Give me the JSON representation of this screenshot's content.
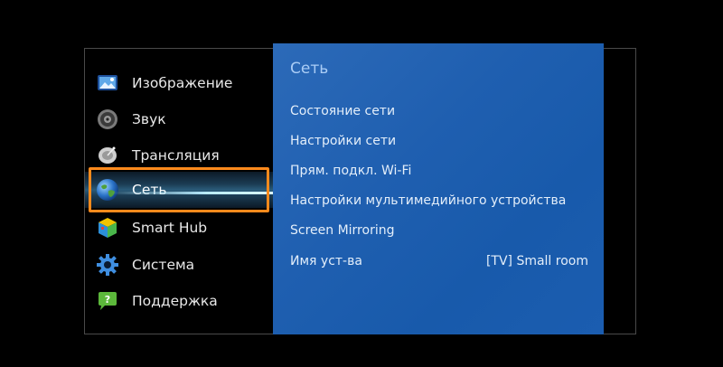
{
  "menu": {
    "items": [
      {
        "label": "Изображение",
        "icon": "picture-icon"
      },
      {
        "label": "Звук",
        "icon": "speaker-icon"
      },
      {
        "label": "Трансляция",
        "icon": "satellite-dish-icon"
      },
      {
        "label": "Сеть",
        "icon": "globe-icon",
        "active": true
      },
      {
        "label": "Smart Hub",
        "icon": "smart-hub-cube-icon"
      },
      {
        "label": "Система",
        "icon": "gear-icon"
      },
      {
        "label": "Поддержка",
        "icon": "support-chat-icon"
      }
    ]
  },
  "panel": {
    "title": "Сеть",
    "options": [
      {
        "label": "Состояние сети",
        "value": ""
      },
      {
        "label": "Настройки сети",
        "value": ""
      },
      {
        "label": "Прям. подкл. Wi-Fi",
        "value": ""
      },
      {
        "label": "Настройки мультимедийного устройства",
        "value": ""
      },
      {
        "label": "Screen Mirroring",
        "value": ""
      },
      {
        "label": "Имя уст-ва",
        "value": "[TV] Small room"
      }
    ]
  },
  "colors": {
    "background": "#000000",
    "panel": "#1f5fb0",
    "highlight_border": "#ff8a1c",
    "panel_title": "#aacdf6"
  }
}
